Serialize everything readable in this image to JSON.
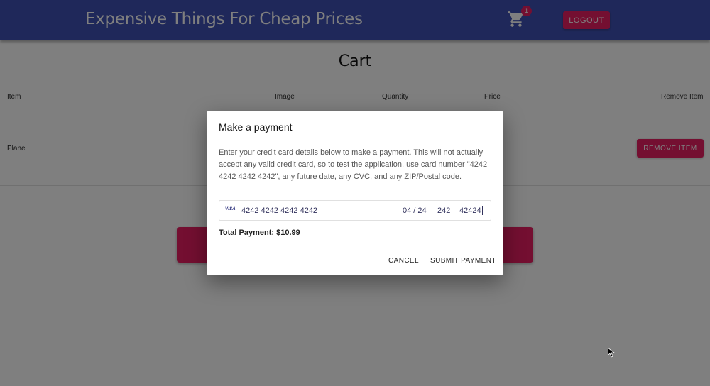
{
  "header": {
    "title": "Expensive Things For Cheap Prices",
    "cart_count": "1",
    "logout_label": "LOGOUT",
    "bg_color": "#3f51b5",
    "accent_color": "#e91e63"
  },
  "page": {
    "title": "Cart"
  },
  "table": {
    "columns": [
      "Item",
      "Image",
      "Quantity",
      "Price",
      "Remove Item"
    ],
    "rows": [
      {
        "item": "Plane",
        "remove_label": "REMOVE ITEM"
      }
    ]
  },
  "dialog": {
    "title": "Make a payment",
    "description": "Enter your credit card details below to make a payment. This will not actually accept any valid credit card, so to test the application, use card number \"4242 4242 4242 4242\", any future date, any CVC, and any ZIP/Postal code.",
    "card": {
      "brand_label": "VISA",
      "number": "4242 4242 4242 4242",
      "expiry": "04 / 24",
      "cvc": "242",
      "zip": "42424"
    },
    "total": "Total Payment: $10.99",
    "cancel_label": "CANCEL",
    "submit_label": "SUBMIT PAYMENT"
  }
}
